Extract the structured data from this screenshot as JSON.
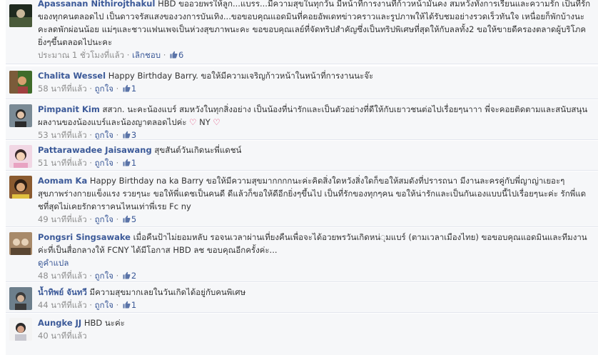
{
  "comments": [
    {
      "author": "Apassanan Nithirojthakul",
      "text": "HBD ขออวยพรให้ลูก...แบรร...มีความสุขในทุกวัน มีหน้าที่การงานที่ก้าวหน้ามั่นคง สมหวังทั้งการเรียนและความรัก เป็นที่รักของทุกคนตลอดไป เป็นดาวจรัสแสงของวงการบันเทิง...ขอขอบคุณแอดมินที่คอยอัพเดทข่าวคราวและรูปภาพให้ได้รับชมอย่างรวดเร็วทันใจ เหนื่อยก็พักบ้างนะคะลดพักผ่อนน้อย แม่ๆและชาวแฟนเพจเป็นห่วงสุขภาพนะคะ ขอขอบคุณเลย์ที่จัดทริปสำคัญซึ่งเป็นทริปพิเศษที่สุดให้กับลลทั้ง2 ขอให้ขายดีครองตลาดผู้บริโภคยิ่งๆขึ้นตลอดไปนะคะ",
      "time": "ประมาณ 1 ชั่วโมงที่แล้ว",
      "like_label": "เลิกชอบ",
      "likes": "6",
      "avatar_colors": [
        "#1f2a1f",
        "#4a5a3a",
        "#c9b79a"
      ]
    },
    {
      "author": "Chalita Wessel",
      "text": "Happy Birthday Barry. ขอให้มีความเจริญก้าวหน้าในหน้าที่การงานนะจ๊ะ",
      "time": "58 นาทีที่แล้ว",
      "like_label": "ถูกใจ",
      "likes": "1",
      "avatar_colors": [
        "#7b5b3a",
        "#3f6b2a",
        "#d8a070"
      ]
    },
    {
      "author": "Pimpanit Kim",
      "text": "สสวก. นะคะน้องแบร์ สมหวังในทุกสิ่งอย่าง เป็นน้องที่น่ารักและเป็นตัวอย่างที่ดีให้กับเยาวชนต่อไปเรื่อยๆนาาา พี่จะคอยติดตามและสนับสนุนผลงานของน้องแบร์และน้องญาตลอดไปค่ะ",
      "text_tail": "NY",
      "time": "53 นาทีที่แล้ว",
      "like_label": "ถูกใจ",
      "likes": "3",
      "avatar_colors": [
        "#2a2a2a",
        "#7a8a95",
        "#e3c3a8"
      ]
    },
    {
      "author": "Pattarawadee Jaisawang",
      "text": "สุขสันต์วันเกิดนะพี่แดชน์",
      "time": "51 นาทีที่แล้ว",
      "like_label": "ถูกใจ",
      "likes": "1",
      "avatar_colors": [
        "#f1d7e4",
        "#e8a3c2",
        "#f5d2b6"
      ]
    },
    {
      "author": "Aomam Ka",
      "text": "Happy Birthday na ka Barry ขอให้มีความสุขมากกกกนะค่ะคิดสิ่งใดหวังสิ่งใดก็ขอให้สมดังที่ปรารถนา มีงานละครคู่กับพี่ญาญ่าเยอะๆ สุขภาพร่างกายแข็งแรง รวยๆนะ ขอให้พี่แดชเป็นคนดี ดีแล้วก็ขอให้ดีอีกยิ่งๆขึ้นไป เป็นที่รักของทุกๆคน ขอให้น่ารักและเป็นกันเองแบบนี้ไปเรื่อยๆนะค่ะ รักพี่แดชที่สุดไม่เคยรักดาราคนไหนเท่าพี่เรย Fc ny",
      "time": "49 นาทีที่แล้ว",
      "like_label": "ถูกใจ",
      "likes": "5",
      "avatar_colors": [
        "#2b1d14",
        "#8a5a2f",
        "#d9a77a"
      ]
    },
    {
      "author": "Pongsri Singsawake",
      "text": "เมื่อคืนป้าไม่ยอมหลับ รอจนเวลาผ่านเที่ยงคืนเพื่อจะได้อวยพรวันเกิดหน่◌ุมแบร์ (ตามเวลาเมืองไทย) ขอขอบคุณแอดมินและทีมงานค่ะที่เป็นสื่อกลางให้ FCNY ได้มีโอกาส HBD ลช ขอบคุณอีกครั้งค่ะ...",
      "translate": "ดูคำแปล",
      "time": "48 นาทีที่แล้ว",
      "like_label": "ถูกใจ",
      "likes": "2",
      "avatar_colors": [
        "#5a4632",
        "#a88a6a",
        "#e6d2b8"
      ]
    },
    {
      "author": "น้ำทิพย์ จันทวี",
      "text": "มีความสุขมากเลยในวันเกิดได้อยู่กับคนพิเศษ",
      "time": "44 นาทีที่แล้ว",
      "like_label": "ถูกใจ",
      "likes": "1",
      "avatar_colors": [
        "#3a3a3a",
        "#6d7f8c",
        "#d4b49a"
      ]
    },
    {
      "author": "Aungke JJ",
      "text": "HBD นะค่ะ",
      "time": "40 นาทีที่แล้ว",
      "avatar_colors": [
        "#f3f3f3",
        "#c8c8d0",
        "#d6a48a"
      ]
    }
  ]
}
